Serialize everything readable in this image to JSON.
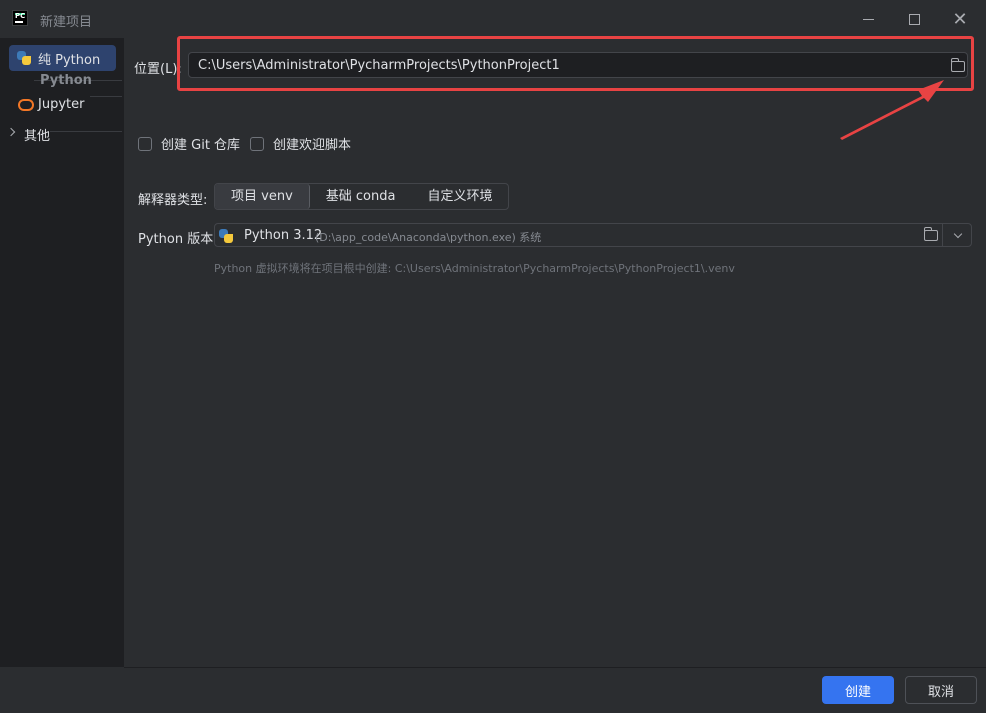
{
  "window": {
    "title": "新建项目"
  },
  "sidebar": {
    "items": [
      {
        "label": "纯 Python",
        "icon": "python-icon",
        "selected": true
      },
      {
        "label": "Jupyter",
        "icon": "jupyter-icon",
        "selected": false
      }
    ],
    "group_label": "Python",
    "other_label": "其他"
  },
  "location": {
    "label": "位置(L):",
    "value": "C:\\Users\\Administrator\\PycharmProjects\\PythonProject1"
  },
  "checkboxes": {
    "git": "创建 Git 仓库",
    "welcome": "创建欢迎脚本"
  },
  "interpreter": {
    "label": "解释器类型:",
    "options": [
      "项目 venv",
      "基础 conda",
      "自定义环境"
    ],
    "selected_index": 0
  },
  "python_version": {
    "label": "Python 版本:",
    "name": "Python 3.12",
    "path": "(D:\\app_code\\Anaconda\\python.exe) 系统"
  },
  "hint": "Python 虚拟环境将在项目根中创建: C:\\Users\\Administrator\\PycharmProjects\\PythonProject1\\.venv",
  "footer": {
    "create_label": "创建",
    "cancel_label": "取消"
  },
  "colors": {
    "accent": "#3574f0",
    "annotation_red": "#e84343",
    "background": "#2b2d30",
    "sidebar_bg": "#1e1f22"
  }
}
